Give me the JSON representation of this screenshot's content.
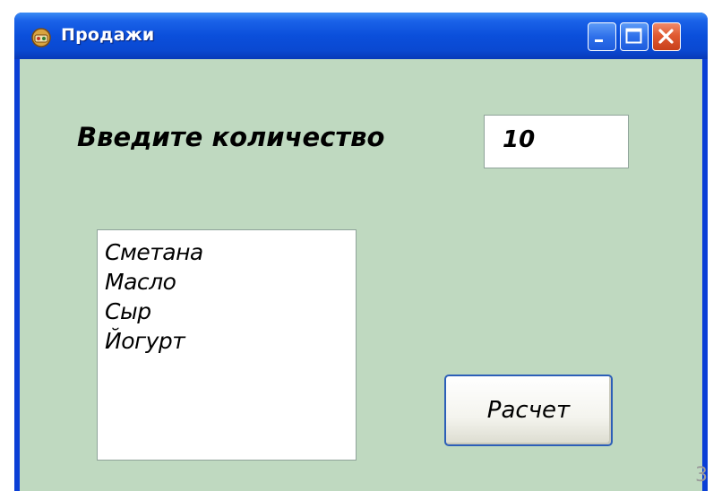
{
  "window": {
    "title": "Продажи"
  },
  "titlebar": {
    "icons": [
      "app-icon",
      "minimize-icon",
      "maximize-icon",
      "close-icon"
    ]
  },
  "form": {
    "prompt_label": "Введите количество",
    "quantity_value": "10",
    "list_items": [
      "Сметана",
      "Масло",
      "Сыр",
      "Йогурт"
    ],
    "calc_button_label": "Расчет"
  },
  "page_number": "3",
  "colors": {
    "titlebar": "#0a49d2",
    "client_background": "#bfd9c0",
    "close_button": "#e05a32",
    "button_border": "#2c5fb8"
  }
}
